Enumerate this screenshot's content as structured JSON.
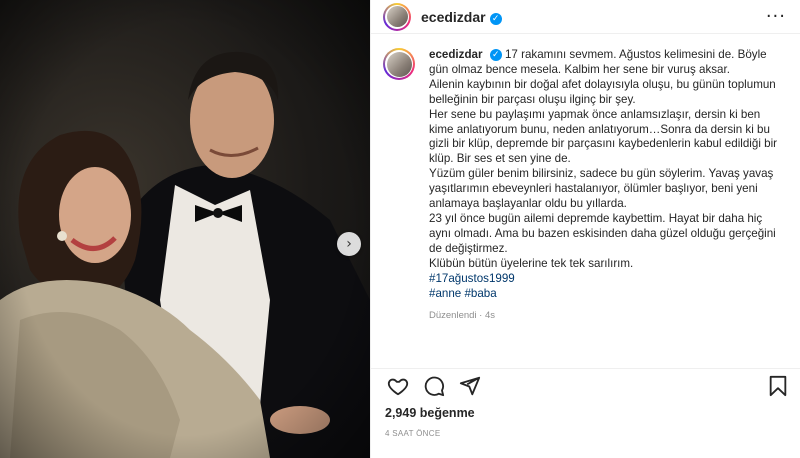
{
  "post": {
    "username": "ecedizdar",
    "verified_icon": "verified-badge-icon",
    "more_icon": "ellipsis-icon",
    "carousel_next_icon": "chevron-right-icon"
  },
  "caption": {
    "username": "ecedizdar",
    "paragraphs": [
      "17 rakamını sevmem. Ağustos kelimesini de. Böyle gün olmaz bence mesela. Kalbim her sene bir vuruş aksar.",
      "Ailenin kaybının bir doğal afet dolayısıyla oluşu, bu günün toplumun belleğinin bir parçası oluşu ilginç bir şey.",
      "Her sene bu paylaşımı yapmak önce anlamsızlaşır, dersin ki ben kime anlatıyorum bunu, neden anlatıyorum…Sonra da dersin ki bu gizli bir klüp, depremde bir parçasını kaybedenlerin kabul edildiği bir klüp. Bir ses et sen yine de.",
      "Yüzüm güler benim bilirsiniz, sadece bu gün söylerim. Yavaş yavaş yaşıtlarımın ebeveynleri hastalanıyor, ölümler başlıyor, beni yeni anlamaya başlayanlar oldu bu yıllarda.",
      "23 yıl önce bugün ailemi depremde kaybettim. Hayat bir daha hiç aynı olmadı. Ama bu bazen eskisinden daha güzel olduğu gerçeğini de değiştirmez.",
      "Klübün bütün üyelerine tek tek sarılırım."
    ],
    "hashtag_line1": "#17ağustos1999",
    "hashtag_line2": "#anne #baba",
    "meta": "Düzenlendi · 4s"
  },
  "actions": {
    "like_icon": "heart-icon",
    "comment_icon": "comment-icon",
    "share_icon": "share-icon",
    "save_icon": "bookmark-icon"
  },
  "likes_text": "2,949 beğenme",
  "time_ago": "4 SAAT ÖNCE",
  "colors": {
    "link": "#00376b",
    "verified": "#0095f6",
    "muted": "#8e8e8e"
  }
}
